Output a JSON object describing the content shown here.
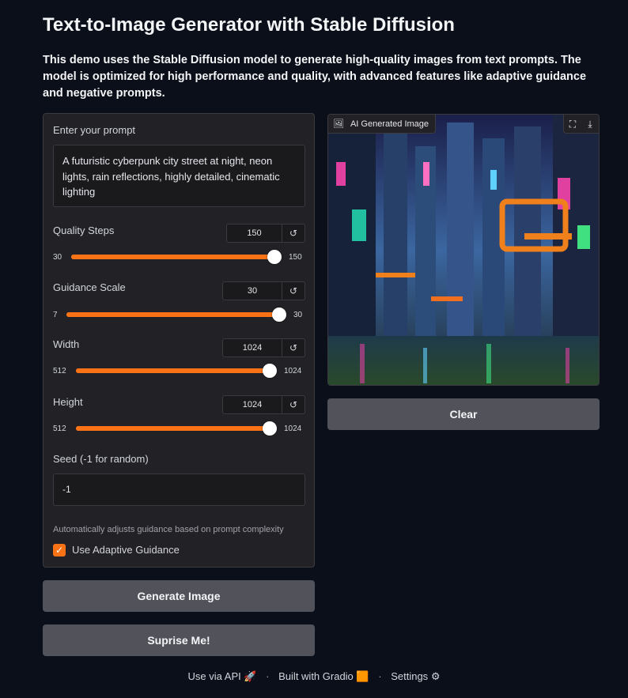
{
  "header": {
    "title": "Text-to-Image Generator with Stable Diffusion",
    "description": "This demo uses the Stable Diffusion model to generate high-quality images from text prompts. The model is optimized for high performance and quality, with advanced features like adaptive guidance and negative prompts."
  },
  "prompt": {
    "label": "Enter your prompt",
    "value": "A futuristic cyberpunk city street at night, neon lights, rain reflections, highly detailed, cinematic lighting"
  },
  "sliders": [
    {
      "label": "Quality Steps",
      "value": "150",
      "min": "30",
      "max": "150",
      "fraction": 1.0
    },
    {
      "label": "Guidance Scale",
      "value": "30",
      "min": "7",
      "max": "30",
      "fraction": 1.0
    },
    {
      "label": "Width",
      "value": "1024",
      "min": "512",
      "max": "1024",
      "fraction": 1.0
    },
    {
      "label": "Height",
      "value": "1024",
      "min": "512",
      "max": "1024",
      "fraction": 1.0
    }
  ],
  "reset_icon": "↺",
  "seed": {
    "label": "Seed (-1 for random)",
    "value": "-1"
  },
  "adaptive": {
    "info": "Automatically adjusts guidance based on prompt complexity",
    "label": "Use Adaptive Guidance",
    "checked": true,
    "check_glyph": "✓"
  },
  "buttons": {
    "generate": "Generate Image",
    "surprise": "Suprise Me!",
    "clear": "Clear"
  },
  "image_panel": {
    "label": "AI Generated Image",
    "image_icon": "🖼",
    "fullscreen_icon": "⛶",
    "download_icon": "⤓"
  },
  "footer": {
    "api": "Use via API",
    "api_icon": "🚀",
    "built": "Built with Gradio",
    "built_icon": "🟧",
    "settings": "Settings",
    "settings_icon": "⚙",
    "sep": "·"
  },
  "colors": {
    "accent": "#f97316",
    "background": "#0b0f19",
    "button": "#52525b"
  }
}
